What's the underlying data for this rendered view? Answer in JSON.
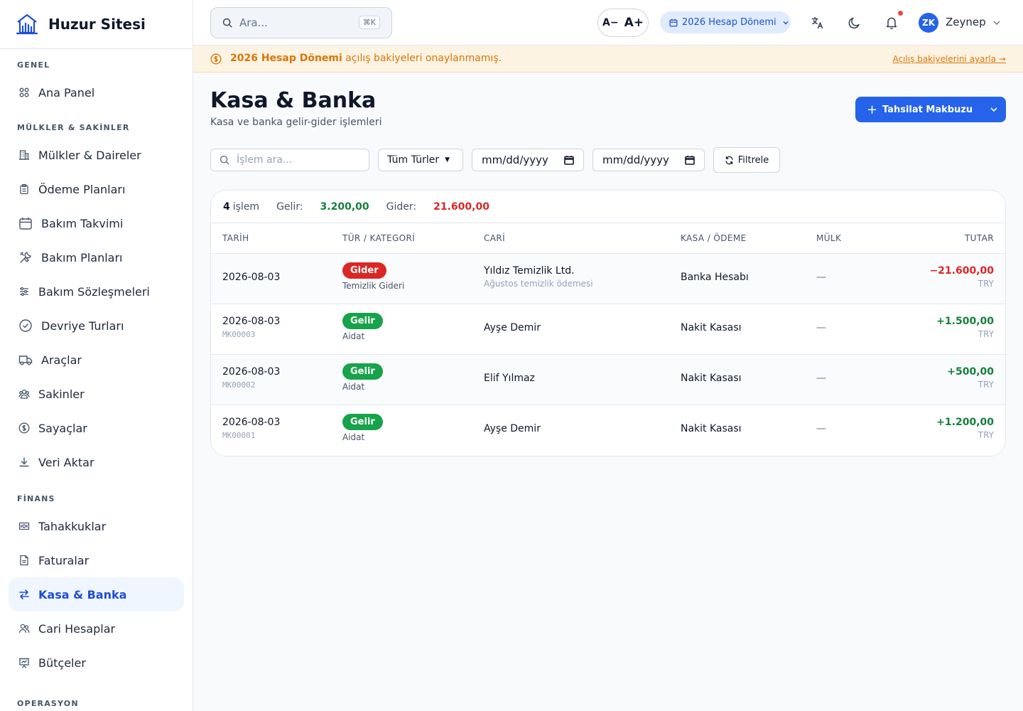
{
  "brand": {
    "name": "Huzur Sitesi"
  },
  "sidebar": {
    "sections": [
      {
        "title": "GENEL",
        "items": [
          {
            "label": "Ana Panel",
            "icon": "grid-icon"
          }
        ]
      },
      {
        "title": "MÜLKLER & SAKİNLER",
        "items": [
          {
            "label": "Mülkler & Daireler",
            "icon": "building-icon"
          },
          {
            "label": "Ödeme Planları",
            "icon": "clipboard-icon"
          },
          {
            "label": "Bakım Takvimi",
            "icon": "calendar-icon"
          },
          {
            "label": "Bakım Planları",
            "icon": "tools-icon"
          },
          {
            "label": "Bakım Sözleşmeleri",
            "icon": "sliders-icon"
          },
          {
            "label": "Devriye Turları",
            "icon": "check-circle-icon"
          },
          {
            "label": "Araçlar",
            "icon": "truck-icon"
          },
          {
            "label": "Sakinler",
            "icon": "users-icon"
          },
          {
            "label": "Sayaçlar",
            "icon": "dollar-circle-icon"
          },
          {
            "label": "Veri Aktar",
            "icon": "download-icon"
          }
        ]
      },
      {
        "title": "FİNANS",
        "items": [
          {
            "label": "Tahakkuklar",
            "icon": "banknote-icon"
          },
          {
            "label": "Faturalar",
            "icon": "file-icon"
          },
          {
            "label": "Kasa & Banka",
            "icon": "transfer-icon",
            "active": true
          },
          {
            "label": "Cari Hesaplar",
            "icon": "people-icon"
          },
          {
            "label": "Bütçeler",
            "icon": "presentation-icon"
          }
        ]
      },
      {
        "title": "OPERASYON",
        "items": []
      }
    ]
  },
  "header": {
    "search_placeholder": "Ara...",
    "search_shortcut": "⌘K",
    "font_decrease": "A−",
    "font_increase": "A+",
    "period": "2026 Hesap Dönemi",
    "user_initials": "ZK",
    "user_name": "Zeynep"
  },
  "banner": {
    "highlight": "2026 Hesap Dönemi",
    "message": " açılış bakiyeleri onaylanmamış.",
    "link": "Açılış bakiyelerini ayarla →"
  },
  "page": {
    "title": "Kasa & Banka",
    "subtitle": "Kasa ve banka gelir-gider işlemleri",
    "primary_button": "Tahsilat Makbuzu"
  },
  "filters": {
    "search_placeholder": "İşlem ara...",
    "type_select": "Tüm Türler",
    "date_from": "mm/dd/yyyy",
    "date_to": "mm/dd/yyyy",
    "filter_button": "Filtrele"
  },
  "summary": {
    "count": "4",
    "count_label": "işlem",
    "income_label": "Gelir:",
    "income_value": "3.200,00",
    "expense_label": "Gider:",
    "expense_value": "21.600,00"
  },
  "table": {
    "columns": [
      "TARİH",
      "TÜR / KATEGORİ",
      "CARİ",
      "KASA / ÖDEME",
      "MÜLK",
      "TUTAR"
    ],
    "rows": [
      {
        "date": "2026-08-03",
        "ref": "",
        "type": "Gider",
        "category": "Temizlik Gideri",
        "party": "Yıldız Temizlik Ltd.",
        "party_note": "Ağustos temizlik ödemesi",
        "account": "Banka Hesabı",
        "property": "—",
        "amount": "−21.600,00",
        "currency": "TRY"
      },
      {
        "date": "2026-08-03",
        "ref": "MK00003",
        "type": "Gelir",
        "category": "Aidat",
        "party": "Ayşe Demir",
        "party_note": "",
        "account": "Nakit Kasası",
        "property": "—",
        "amount": "+1.500,00",
        "currency": "TRY"
      },
      {
        "date": "2026-08-03",
        "ref": "MK00002",
        "type": "Gelir",
        "category": "Aidat",
        "party": "Elif Yılmaz",
        "party_note": "",
        "account": "Nakit Kasası",
        "property": "—",
        "amount": "+500,00",
        "currency": "TRY"
      },
      {
        "date": "2026-08-03",
        "ref": "MK00001",
        "type": "Gelir",
        "category": "Aidat",
        "party": "Ayşe Demir",
        "party_note": "",
        "account": "Nakit Kasası",
        "property": "—",
        "amount": "+1.200,00",
        "currency": "TRY"
      }
    ]
  },
  "colors": {
    "accent": "#2563eb",
    "income": "#15803d",
    "expense": "#dc2626",
    "warning": "#d97706"
  }
}
